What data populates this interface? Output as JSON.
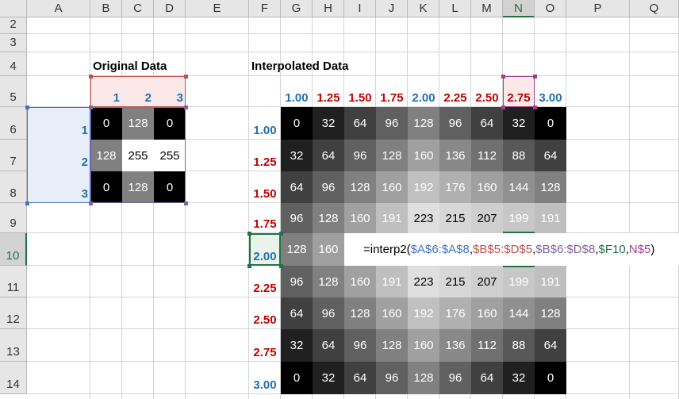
{
  "columns": [
    "A",
    "B",
    "C",
    "D",
    "E",
    "F",
    "G",
    "H",
    "I",
    "J",
    "K",
    "L",
    "M",
    "N",
    "O",
    "P",
    "Q"
  ],
  "rows": [
    "2",
    "3",
    "4",
    "5",
    "6",
    "7",
    "8",
    "9",
    "10",
    "11",
    "12",
    "13",
    "14"
  ],
  "selected_column": "N",
  "selected_row": "10",
  "original": {
    "title": "Original Data",
    "col_axis": [
      "1",
      "2",
      "3"
    ],
    "row_axis": [
      "1",
      "2",
      "3"
    ],
    "values": [
      [
        0,
        128,
        0
      ],
      [
        128,
        255,
        255
      ],
      [
        0,
        128,
        0
      ]
    ]
  },
  "interpolated": {
    "title": "Interpolated Data",
    "col_axis": [
      "1.00",
      "1.25",
      "1.50",
      "1.75",
      "2.00",
      "2.25",
      "2.50",
      "2.75",
      "3.00"
    ],
    "row_axis": [
      "1.00",
      "1.25",
      "1.50",
      "1.75",
      "2.00",
      "2.25",
      "2.50",
      "2.75",
      "3.00"
    ],
    "values": [
      [
        0,
        32,
        64,
        96,
        128,
        96,
        64,
        32,
        0
      ],
      [
        32,
        64,
        96,
        128,
        160,
        136,
        112,
        88,
        64
      ],
      [
        64,
        96,
        128,
        160,
        192,
        176,
        160,
        144,
        128
      ],
      [
        96,
        128,
        160,
        191,
        223,
        215,
        207,
        199,
        191
      ],
      [
        128,
        160,
        null,
        null,
        null,
        null,
        null,
        null,
        null
      ],
      [
        96,
        128,
        160,
        191,
        223,
        215,
        207,
        199,
        191
      ],
      [
        64,
        96,
        128,
        160,
        192,
        176,
        160,
        144,
        128
      ],
      [
        32,
        64,
        96,
        128,
        160,
        136,
        112,
        88,
        64
      ],
      [
        0,
        32,
        64,
        96,
        128,
        96,
        64,
        32,
        0
      ]
    ]
  },
  "formula": {
    "prefix": "=interp2(",
    "arg1": "$A$6:$A$8",
    "sep1": ",",
    "arg2": "$B$5:$D$5",
    "sep2": ",",
    "arg3": "$B$6:$D$8",
    "sep3": ",",
    "arg4": "$F10",
    "sep4": ",",
    "arg5": "N$5",
    "suffix": ")"
  },
  "colors": {
    "axis_blue": "#1f6fb5",
    "axis_red": "#c00000",
    "ref_blue": "#4472c4",
    "ref_red": "#c0504d",
    "ref_purple": "#8064a2",
    "ref_green": "#217346",
    "ref_magenta": "#a0408c"
  }
}
